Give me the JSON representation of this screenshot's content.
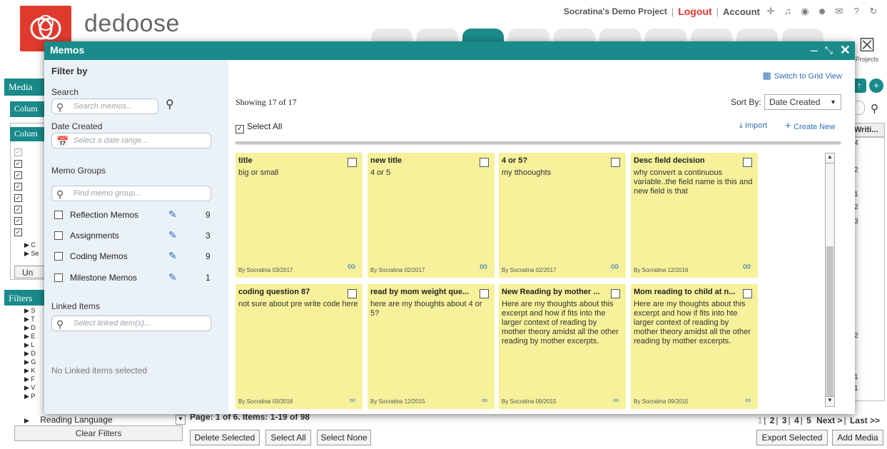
{
  "header": {
    "brand": "dedoose",
    "project": "Socratina's Demo Project",
    "logout": "Logout",
    "account": "Account",
    "projects_btn": "Projects"
  },
  "background": {
    "media_title": "Media",
    "columns_title": "Colum",
    "columns_sub": "Colum",
    "un_btn": "Un",
    "filters_title": "Filters",
    "tree_letters": [
      "C",
      "Se",
      "S",
      "T",
      "D",
      "E",
      "L",
      "D",
      "G",
      "K",
      "F",
      "V",
      "P"
    ],
    "reading_language": "Reading Language",
    "clear_filters": "Clear Filters",
    "right_col_header": "Writi...",
    "right_nums": [
      "4",
      "2",
      "1",
      "2",
      "3",
      "2",
      "1",
      "1"
    ]
  },
  "bottom": {
    "page_info": "Page: 1 of 6. Items: 1-19 of 98",
    "pager": {
      "current": "1",
      "pages": [
        "2",
        "3",
        "4",
        "5"
      ],
      "next": "Next >",
      "last": "Last >>"
    },
    "delete_selected": "Delete Selected",
    "select_all": "Select All",
    "select_none": "Select None",
    "export_selected": "Export Selected",
    "add_media": "Add Media"
  },
  "memos_modal": {
    "title": "Memos",
    "filter": {
      "heading": "Filter by",
      "search_label": "Search",
      "search_placeholder": "Search memos...",
      "date_label": "Date Created",
      "date_placeholder": "Select a date range...",
      "groups_label": "Memo Groups",
      "groups_placeholder": "Find memo group...",
      "groups": [
        {
          "name": "Reflection Memos",
          "count": "9"
        },
        {
          "name": "Assignments",
          "count": "3"
        },
        {
          "name": "Coding Memos",
          "count": "9"
        },
        {
          "name": "Milestone Memos",
          "count": "1"
        }
      ],
      "linked_label": "Linked Items",
      "linked_placeholder": "Select linked item(s)...",
      "no_linked": "No Linked items selected"
    },
    "main": {
      "grid_view": "Switch to Grid View",
      "showing": "Showing 17 of 17",
      "sort_by_label": "Sort By:",
      "sort_by_value": "Date Created",
      "select_all": "Select All",
      "import": "Import",
      "create_new": "Create New",
      "cards": [
        {
          "title": "title",
          "body": "big or small",
          "meta": "By Socratina 03/2017"
        },
        {
          "title": "new title",
          "body": "4 or 5",
          "meta": "By Socratina 02/2017"
        },
        {
          "title": "4 or 5?",
          "body": "my tthooughts",
          "meta": "By Socratina 02/2017"
        },
        {
          "title": "Desc field decision",
          "body": "why convert a continuous variable..the field name is this and new field is  that",
          "meta": "By Socratina 12/2016"
        },
        {
          "title": "coding question 87",
          "body": "not sure about pre write code here",
          "meta": "By Socratina 03/2016"
        },
        {
          "title": "read by mom weight que...",
          "body": "here are my thoughts about 4 or 5?",
          "meta": "By Socratina 12/2015"
        },
        {
          "title": "New Reading by mother ...",
          "body": "Here are my thoughts about this excerpt and how if fits into the larger context of reading by mother theory amidst all the other reading by mother excerpts.",
          "meta": "By Socratina 09/2015"
        },
        {
          "title": "Mom reading to child at n...",
          "body": "Here are my thoughts about this excerpt and how if fits into hte larger context of reading by mother theory amidst all the other reading by mother excerpts.",
          "meta": "By Socratina 09/2015"
        }
      ]
    }
  },
  "colors": {
    "teal": "#1a8a8a",
    "logo_red": "#e03a2f",
    "card_yellow": "#f6f19a",
    "link_blue": "#2f6fb5"
  }
}
